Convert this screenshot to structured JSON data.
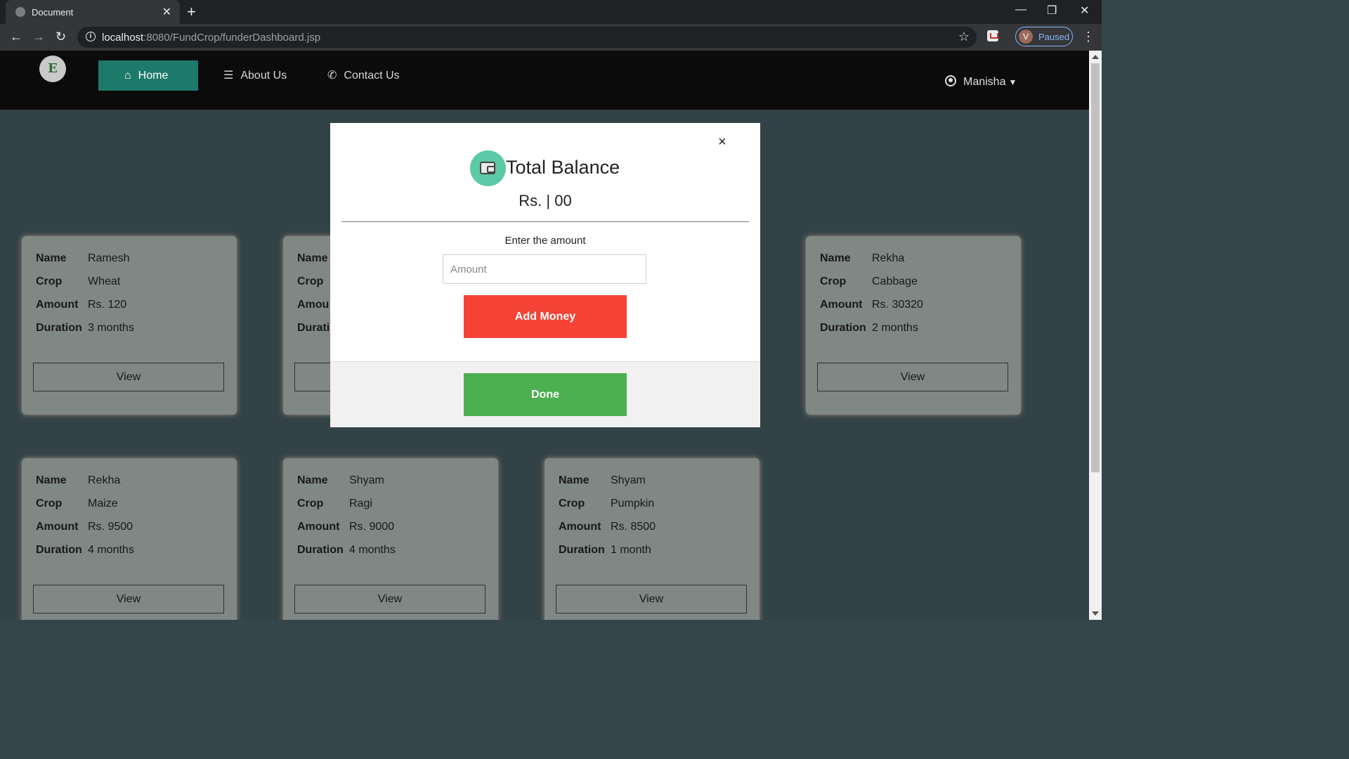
{
  "browser": {
    "tab_title": "Document",
    "url_host": "localhost",
    "url_rest": ":8080/FundCrop/funderDashboard.jsp",
    "profile_initial": "V",
    "profile_status": "Paused"
  },
  "navbar": {
    "logo_text": "E",
    "links": [
      {
        "label": "Home",
        "active": true
      },
      {
        "label": "About Us",
        "active": false
      },
      {
        "label": "Contact Us",
        "active": false
      }
    ],
    "user_name": "Manisha"
  },
  "card_labels": {
    "name": "Name",
    "crop": "Crop",
    "amount": "Amount",
    "duration": "Duration",
    "button": "View"
  },
  "cards": [
    {
      "name": "Ramesh",
      "crop": "Wheat",
      "amount": "Rs. 120",
      "duration": "3 months"
    },
    {
      "name": "",
      "crop": "",
      "amount": "",
      "duration": ""
    },
    {
      "name": "Rekha",
      "crop": "Cabbage",
      "amount": "Rs. 30320",
      "duration": "2 months"
    },
    {
      "name": "Rekha",
      "crop": "Maize",
      "amount": "Rs. 9500",
      "duration": "4 months"
    },
    {
      "name": "Shyam",
      "crop": "Ragi",
      "amount": "Rs. 9000",
      "duration": "4 months"
    },
    {
      "name": "Shyam",
      "crop": "Pumpkin",
      "amount": "Rs. 8500",
      "duration": "1 month"
    }
  ],
  "partial_card_labels": {
    "name": "Name",
    "crop": "Crop",
    "amount": "Amou",
    "duration": "Durati"
  },
  "modal": {
    "title": "Total Balance",
    "balance": "Rs. | 00",
    "amount_label": "Enter the amount",
    "amount_placeholder": "Amount",
    "amount_value": "",
    "add_button": "Add Money",
    "done_button": "Done",
    "close_symbol": "×"
  },
  "colors": {
    "page_bg": "#35464b",
    "nav_active": "#1d7a6b",
    "add_money": "#f44336",
    "done": "#4caf50",
    "wallet_circle": "#5cc9a7",
    "card_bg": "#87908e"
  }
}
